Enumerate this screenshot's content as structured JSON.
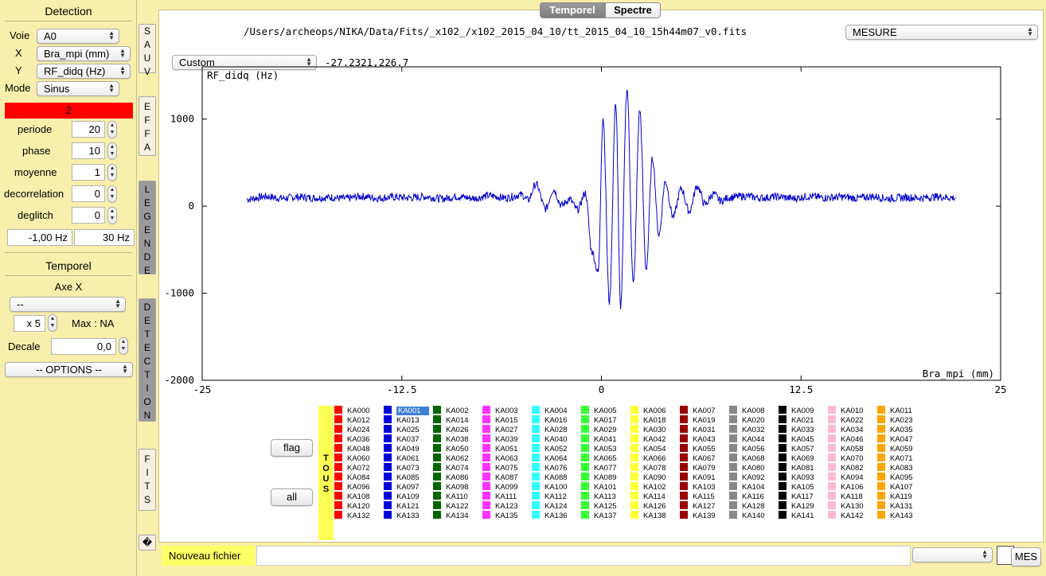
{
  "left": {
    "detection_title": "Detection",
    "voie_label": "Voie",
    "voie_value": "A0",
    "x_label": "X",
    "x_value": "Bra_mpi (mm)",
    "y_label": "Y",
    "y_value": "RF_didq (Hz)",
    "mode_label": "Mode",
    "mode_value": "Sinus",
    "alert_value": "2",
    "params": [
      {
        "label": "periode",
        "value": "20"
      },
      {
        "label": "phase",
        "value": "10"
      },
      {
        "label": "moyenne",
        "value": "1"
      },
      {
        "label": "decorrelation",
        "value": "0"
      },
      {
        "label": "deglitch",
        "value": "0"
      }
    ],
    "freq_min": "-1,00 Hz",
    "freq_max": "30 Hz",
    "temporel_title": "Temporel",
    "axe_x_title": "Axe X",
    "axe_x_value": "--",
    "scale_value": "x 5",
    "max_label": "Max : NA",
    "decale_label": "Decale",
    "decale_value": "0,0",
    "options_label": "-- OPTIONS --"
  },
  "vtabs": {
    "sauv": [
      "S",
      "A",
      "U",
      "V"
    ],
    "effa": [
      "E",
      "F",
      "F",
      "A"
    ],
    "legende": [
      "L",
      "E",
      "G",
      "E",
      "N",
      "D",
      "E"
    ],
    "detection": [
      "D",
      "E",
      "T",
      "E",
      "C",
      "T",
      "I",
      "O",
      "N"
    ],
    "fits": [
      "F",
      "I",
      "T",
      "S"
    ],
    "unknown": "�"
  },
  "main": {
    "tab_active": "Temporel",
    "tab_inactive": "Spectre",
    "file_path": "/Users/archeops/NIKA/Data/Fits/_x102_/x102_2015_04_10/tt_2015_04_10_15h44m07_v0.fits",
    "measure_select": "MESURE",
    "range_select": "Custom",
    "coords": "-27.2321,226.7",
    "flag_button": "flag",
    "all_button": "all",
    "tous_label": [
      "T",
      "O",
      "U",
      "S"
    ],
    "new_file_label": "Nouveau fichier",
    "mes_button": "MES"
  },
  "chart_data": {
    "type": "line",
    "ylabel": "RF_didq (Hz)",
    "xlabel": "Bra_mpi (mm)",
    "xlim": [
      -25,
      25
    ],
    "ylim": [
      -2000,
      1600
    ],
    "xticks": [
      "-25",
      "-12.5",
      "0",
      "12.5",
      "25"
    ],
    "yticks": [
      "-2000",
      "-1000",
      "0",
      "1000"
    ],
    "series": [
      {
        "color": "#0000cc",
        "x": [
          -22.2,
          -21,
          -20,
          -19,
          -18,
          -17,
          -16,
          -15,
          -14,
          -13,
          -12,
          -11,
          -10,
          -9,
          -8,
          -7,
          -6,
          -5,
          -4.6,
          -4.1,
          -3.5,
          -3.0,
          -2.5,
          -2.0,
          -1.5,
          -1.0,
          -0.6,
          -0.2,
          0.1,
          0.5,
          0.9,
          1.2,
          1.6,
          2.0,
          2.4,
          2.8,
          3.2,
          3.6,
          4.0,
          4.5,
          5.0,
          5.5,
          6.0,
          6.5,
          7.0,
          7.5,
          8,
          9,
          10,
          11,
          12,
          13,
          14,
          15,
          16,
          17,
          18,
          19,
          20,
          21,
          22.2
        ],
        "y": [
          80,
          110,
          90,
          105,
          95,
          100,
          88,
          112,
          92,
          104,
          96,
          108,
          85,
          110,
          90,
          120,
          95,
          130,
          70,
          250,
          -30,
          190,
          10,
          80,
          -40,
          150,
          -520,
          -760,
          1020,
          -1100,
          1180,
          -1150,
          1350,
          -900,
          1100,
          -720,
          550,
          -330,
          280,
          -120,
          200,
          -60,
          230,
          20,
          140,
          60,
          100,
          115,
          95,
          108,
          90,
          112,
          96,
          105,
          92,
          110,
          88,
          100,
          94,
          108,
          95
        ]
      }
    ]
  },
  "detectors": {
    "columns": [
      {
        "color": "#ff0000",
        "ids": [
          "KA000",
          "KA012",
          "KA024",
          "KA036",
          "KA048",
          "KA060",
          "KA072",
          "KA084",
          "KA096",
          "KA108",
          "KA120",
          "KA132"
        ]
      },
      {
        "color": "#0000dd",
        "ids": [
          "KA001",
          "KA013",
          "KA025",
          "KA037",
          "KA049",
          "KA061",
          "KA073",
          "KA085",
          "KA097",
          "KA109",
          "KA121",
          "KA133"
        ]
      },
      {
        "color": "#006600",
        "ids": [
          "KA002",
          "KA014",
          "KA026",
          "KA038",
          "KA050",
          "KA062",
          "KA074",
          "KA086",
          "KA098",
          "KA110",
          "KA122",
          "KA134"
        ]
      },
      {
        "color": "#ff33ff",
        "ids": [
          "KA003",
          "KA015",
          "KA027",
          "KA039",
          "KA051",
          "KA063",
          "KA075",
          "KA087",
          "KA099",
          "KA111",
          "KA123",
          "KA135"
        ]
      },
      {
        "color": "#33ffff",
        "ids": [
          "KA004",
          "KA016",
          "KA028",
          "KA040",
          "KA052",
          "KA064",
          "KA076",
          "KA088",
          "KA100",
          "KA112",
          "KA124",
          "KA136"
        ]
      },
      {
        "color": "#33ff33",
        "ids": [
          "KA005",
          "KA017",
          "KA029",
          "KA041",
          "KA053",
          "KA065",
          "KA077",
          "KA089",
          "KA101",
          "KA113",
          "KA125",
          "KA137"
        ]
      },
      {
        "color": "#ffff33",
        "ids": [
          "KA006",
          "KA018",
          "KA030",
          "KA042",
          "KA054",
          "KA066",
          "KA078",
          "KA090",
          "KA102",
          "KA114",
          "KA126",
          "KA138"
        ]
      },
      {
        "color": "#990000",
        "ids": [
          "KA007",
          "KA019",
          "KA031",
          "KA043",
          "KA055",
          "KA067",
          "KA079",
          "KA091",
          "KA103",
          "KA115",
          "KA127",
          "KA139"
        ]
      },
      {
        "color": "#888888",
        "ids": [
          "KA008",
          "KA020",
          "KA032",
          "KA044",
          "KA056",
          "KA068",
          "KA080",
          "KA092",
          "KA104",
          "KA116",
          "KA128",
          "KA140"
        ]
      },
      {
        "color": "#000000",
        "ids": [
          "KA009",
          "KA021",
          "KA033",
          "KA045",
          "KA057",
          "KA069",
          "KA081",
          "KA093",
          "KA105",
          "KA117",
          "KA129",
          "KA141"
        ]
      },
      {
        "color": "#ffbbcc",
        "ids": [
          "KA010",
          "KA022",
          "KA034",
          "KA046",
          "KA058",
          "KA070",
          "KA082",
          "KA094",
          "KA106",
          "KA118",
          "KA130",
          "KA142"
        ]
      },
      {
        "color": "#ffa500",
        "ids": [
          "KA011",
          "KA023",
          "KA035",
          "KA047",
          "KA059",
          "KA071",
          "KA083",
          "KA095",
          "KA107",
          "KA119",
          "KA131",
          "KA143"
        ]
      }
    ],
    "selected": "KA001"
  }
}
